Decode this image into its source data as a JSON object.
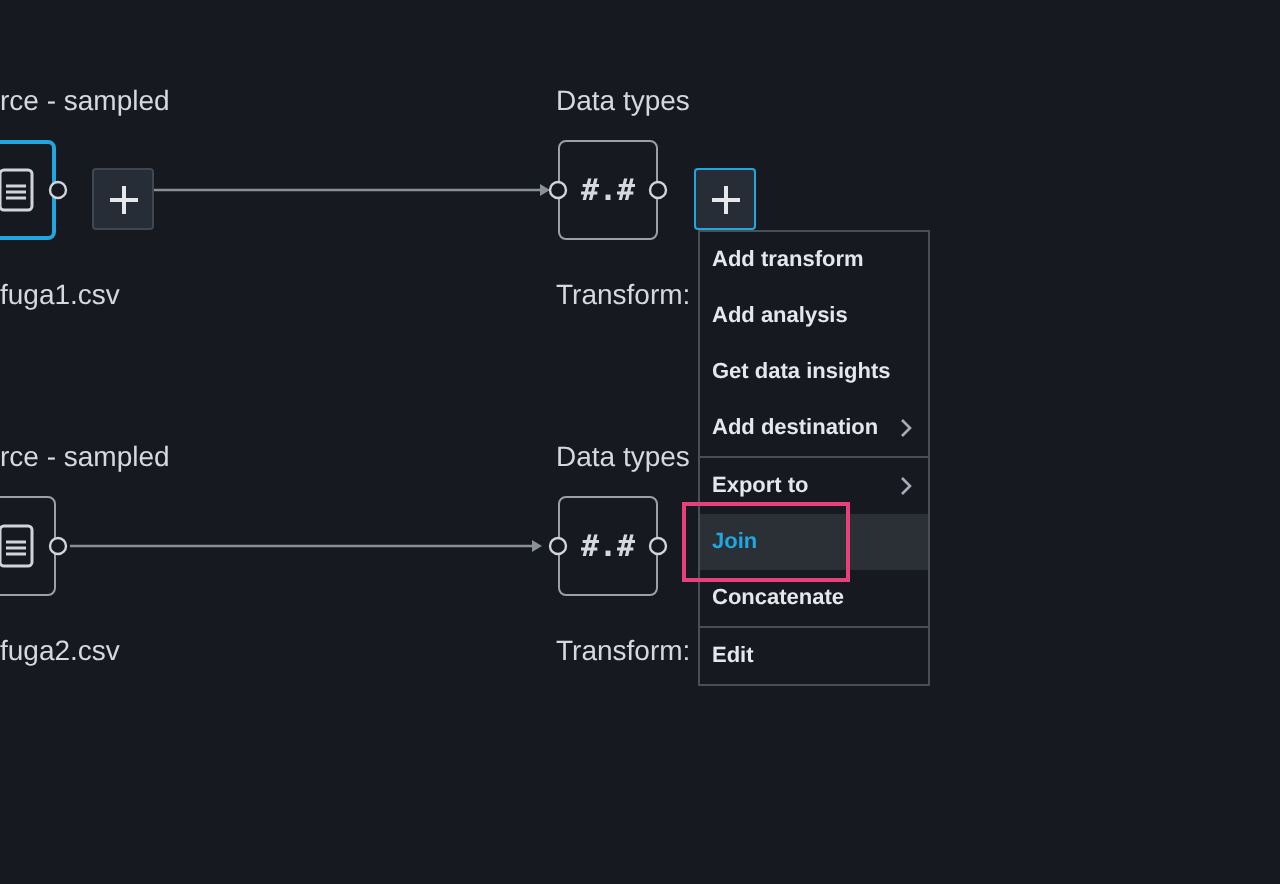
{
  "flows": [
    {
      "source": {
        "title": "rce - sampled",
        "file": "fuga1.csv",
        "selected": true
      },
      "add_button": true,
      "target": {
        "title": "Data types",
        "glyph": "#.#",
        "caption": "Transform:"
      }
    },
    {
      "source": {
        "title": "rce - sampled",
        "file": "fuga2.csv",
        "selected": false
      },
      "add_button": false,
      "target": {
        "title": "Data types",
        "glyph": "#.#",
        "caption": "Transform:"
      }
    }
  ],
  "target_add_button": {
    "active": true
  },
  "menu": {
    "sections": [
      [
        {
          "label": "Add transform",
          "submenu": false,
          "selected": false,
          "annotated": false
        },
        {
          "label": "Add analysis",
          "submenu": false,
          "selected": false,
          "annotated": false
        },
        {
          "label": "Get data insights",
          "submenu": false,
          "selected": false,
          "annotated": false
        },
        {
          "label": "Add destination",
          "submenu": true,
          "selected": false,
          "annotated": false
        }
      ],
      [
        {
          "label": "Export to",
          "submenu": true,
          "selected": false,
          "annotated": false
        },
        {
          "label": "Join",
          "submenu": false,
          "selected": true,
          "annotated": true
        },
        {
          "label": "Concatenate",
          "submenu": false,
          "selected": false,
          "annotated": false
        }
      ],
      [
        {
          "label": "Edit",
          "submenu": false,
          "selected": false,
          "annotated": false
        }
      ]
    ]
  }
}
